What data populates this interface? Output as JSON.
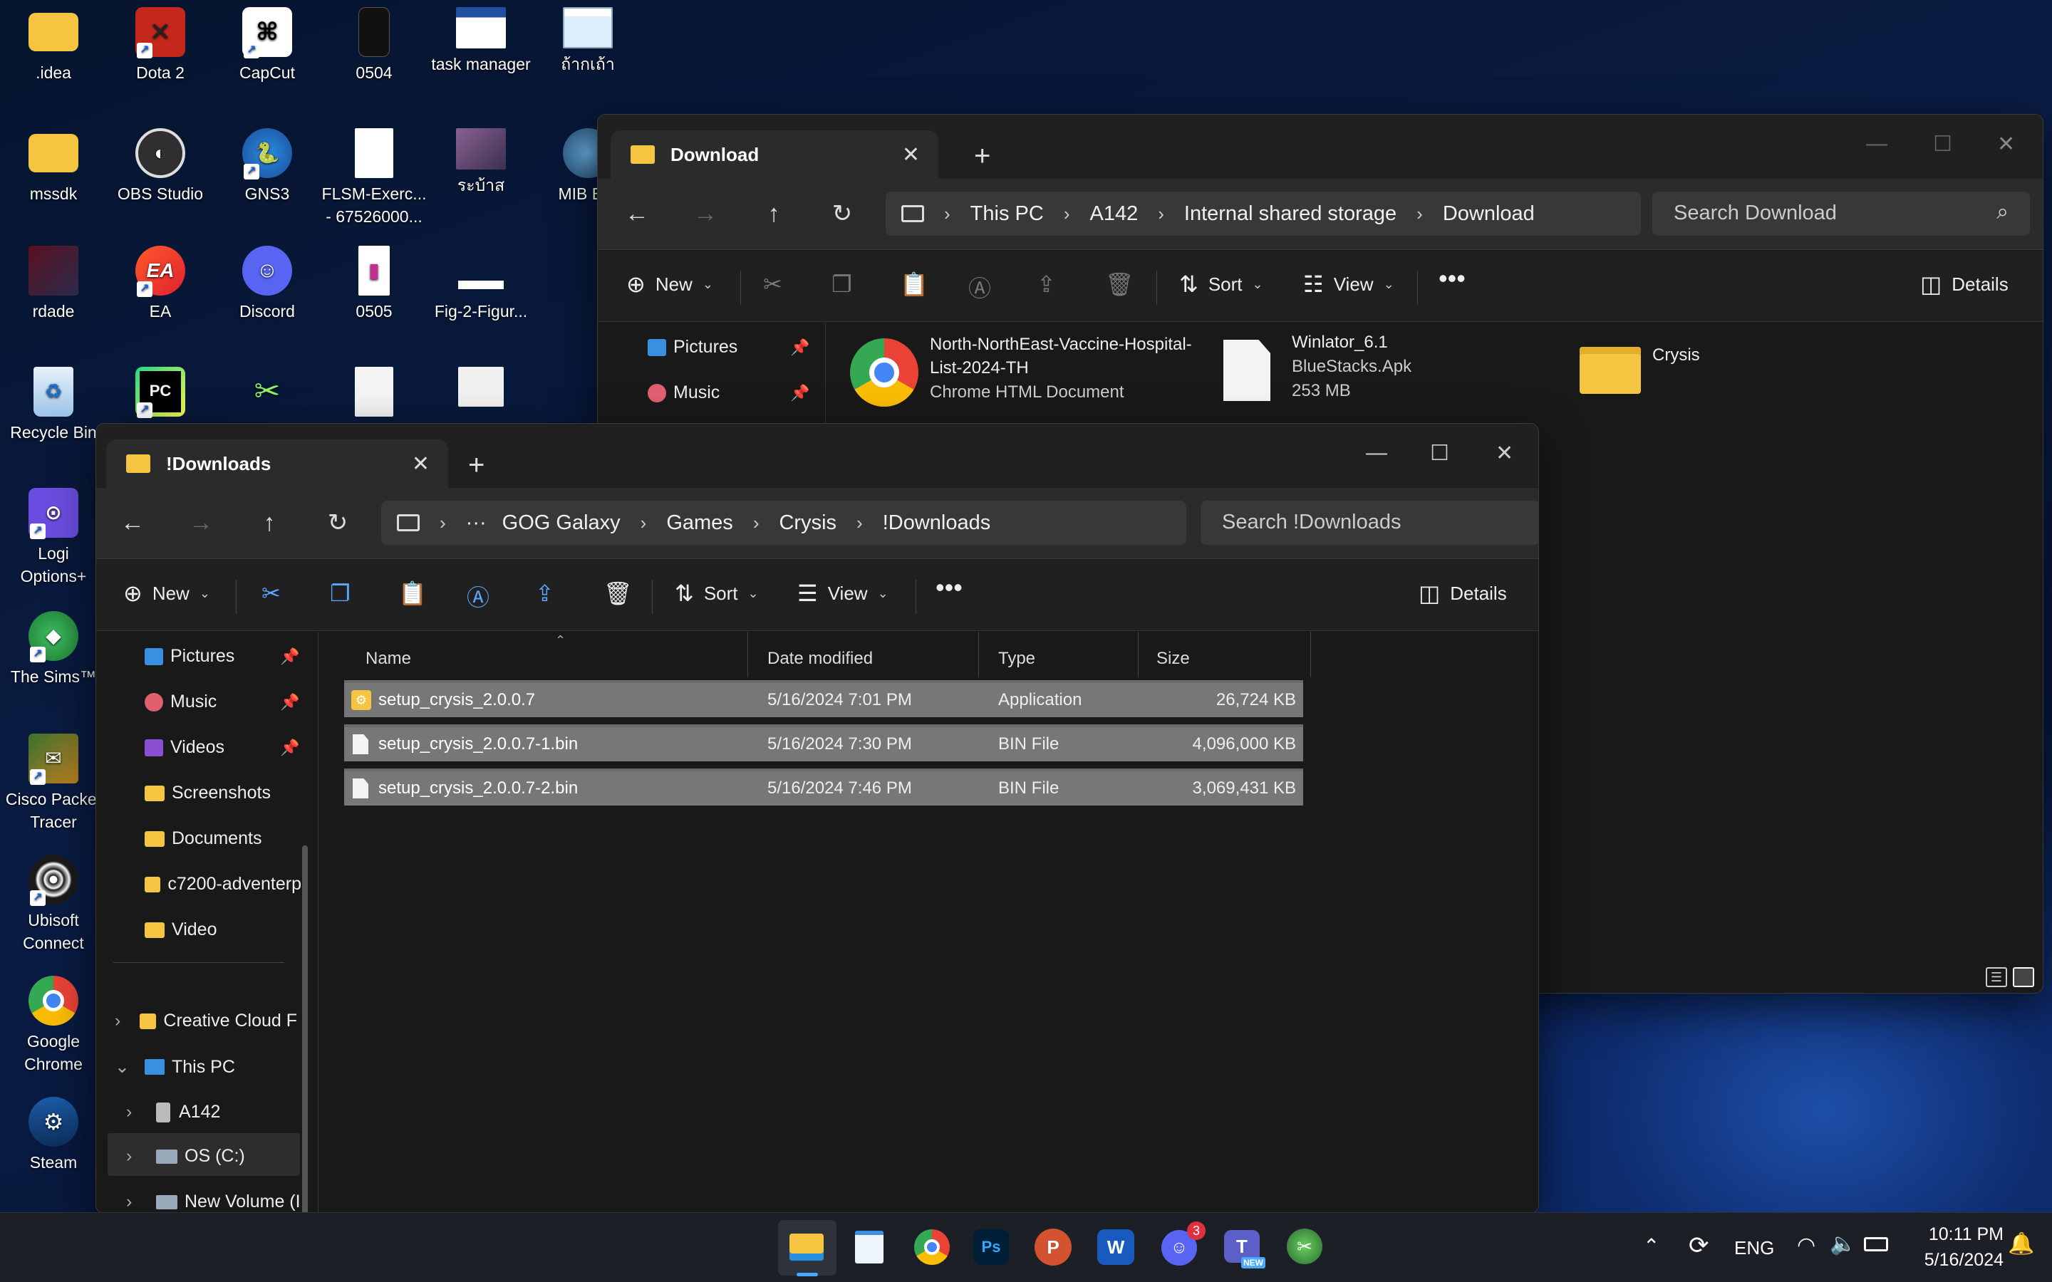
{
  "desktop": {
    "icons": [
      {
        "label": ".idea"
      },
      {
        "label": "Dota 2"
      },
      {
        "label": "CapCut"
      },
      {
        "label": "0504"
      },
      {
        "label": "task manager"
      },
      {
        "label": "ถ้ากเถ้า"
      },
      {
        "label": "mssdk"
      },
      {
        "label": "OBS Studio"
      },
      {
        "label": "GNS3"
      },
      {
        "label": "FLSM-Exerc... - 67526000..."
      },
      {
        "label": "ระบ้าส"
      },
      {
        "label": "MIB Bro"
      },
      {
        "label": "rdade"
      },
      {
        "label": "EA"
      },
      {
        "label": "Discord"
      },
      {
        "label": "0505"
      },
      {
        "label": "Fig-2-Figur..."
      },
      {
        "label": "Recycle Bin"
      },
      {
        "label": "Logi Options+"
      },
      {
        "label": "The Sims™"
      },
      {
        "label": "Cisco Packet Tracer"
      },
      {
        "label": "Ubisoft Connect"
      },
      {
        "label": "Google Chrome"
      },
      {
        "label": "Steam"
      }
    ]
  },
  "window_back": {
    "tab_title": "Download",
    "breadcrumb": [
      "This PC",
      "A142",
      "Internal shared storage",
      "Download"
    ],
    "search_placeholder": "Search Download",
    "cmd": {
      "new": "New",
      "sort": "Sort",
      "view": "View",
      "details": "Details"
    },
    "nav": [
      {
        "label": "Pictures"
      },
      {
        "label": "Music"
      }
    ],
    "items": [
      {
        "name": "North-NorthEast-Vaccine-Hospital-List-2024-TH",
        "type": "Chrome HTML Document"
      },
      {
        "name": "Winlator_6.1",
        "type": "BlueStacks.Apk",
        "size": "253 MB"
      },
      {
        "name": "Crysis"
      }
    ]
  },
  "window_front": {
    "tab_title": "!Downloads",
    "breadcrumb": [
      "GOG Galaxy",
      "Games",
      "Crysis",
      "!Downloads"
    ],
    "breadcrumb_more": "···",
    "search_placeholder": "Search !Downloads",
    "cmd": {
      "new": "New",
      "sort": "Sort",
      "view": "View",
      "details": "Details"
    },
    "nav": [
      {
        "label": "Pictures",
        "pinned": true
      },
      {
        "label": "Music",
        "pinned": true
      },
      {
        "label": "Videos",
        "pinned": true
      },
      {
        "label": "Screenshots"
      },
      {
        "label": "Documents"
      },
      {
        "label": "c7200-adventerp"
      },
      {
        "label": "Video"
      },
      {
        "label": "Creative Cloud F"
      },
      {
        "label": "This PC"
      },
      {
        "label": "A142"
      },
      {
        "label": "OS (C:)"
      },
      {
        "label": "New Volume (I"
      }
    ],
    "columns": {
      "name": "Name",
      "date": "Date modified",
      "type": "Type",
      "size": "Size"
    },
    "files": [
      {
        "name": "setup_crysis_2.0.0.7",
        "date": "5/16/2024 7:01 PM",
        "type": "Application",
        "size": "26,724 KB"
      },
      {
        "name": "setup_crysis_2.0.0.7-1.bin",
        "date": "5/16/2024 7:30 PM",
        "type": "BIN File",
        "size": "4,096,000 KB"
      },
      {
        "name": "setup_crysis_2.0.0.7-2.bin",
        "date": "5/16/2024 7:46 PM",
        "type": "BIN File",
        "size": "3,069,431 KB"
      }
    ]
  },
  "taskbar": {
    "language": "ENG",
    "time": "10:11 PM",
    "date": "5/16/2024",
    "discord_badge": "3",
    "teams_badge": "NEW"
  },
  "colors": {
    "folder": "#f5c542",
    "accent": "#0a7fe0",
    "selected_row": "#777777"
  }
}
